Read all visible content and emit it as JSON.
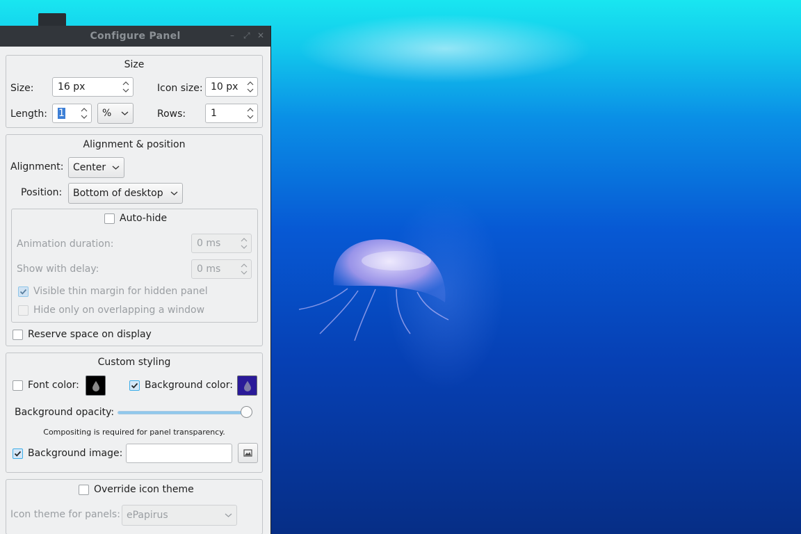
{
  "window": {
    "title": "Configure Panel"
  },
  "size_group": {
    "title": "Size",
    "size_label": "Size:",
    "size_value": "16 px",
    "icon_size_label": "Icon size:",
    "icon_size_value": "10 px",
    "length_label": "Length:",
    "length_value": "1",
    "length_unit": "%",
    "rows_label": "Rows:",
    "rows_value": "1"
  },
  "alignment_group": {
    "title": "Alignment & position",
    "alignment_label": "Alignment:",
    "alignment_value": "Center",
    "position_label": "Position:",
    "position_value": "Bottom of desktop",
    "autohide": {
      "label": "Auto-hide",
      "checked": false,
      "animation_label": "Animation duration:",
      "animation_value": "0 ms",
      "delay_label": "Show with delay:",
      "delay_value": "0 ms",
      "thin_margin_label": "Visible thin margin for hidden panel",
      "thin_margin_checked": true,
      "overlap_label": "Hide only on overlapping a window",
      "overlap_checked": false
    },
    "reserve_label": "Reserve space on display",
    "reserve_checked": false
  },
  "styling_group": {
    "title": "Custom styling",
    "font_color_label": "Font color:",
    "font_color_checked": false,
    "font_color": "#000000",
    "bg_color_label": "Background color:",
    "bg_color_checked": true,
    "bg_color": "#2a1a99",
    "opacity_label": "Background opacity:",
    "opacity_value": 1.0,
    "compositing_note": "Compositing is required for panel transparency.",
    "bg_image_label": "Background image:",
    "bg_image_checked": true,
    "bg_image_value": ""
  },
  "icon_theme_group": {
    "override_label": "Override icon theme",
    "override_checked": false,
    "theme_label": "Icon theme for panels:",
    "theme_value": "ePapirus"
  },
  "colors": {
    "accent": "#3daee9",
    "titlebar": "#32363b",
    "window_bg": "#eff0f1"
  }
}
